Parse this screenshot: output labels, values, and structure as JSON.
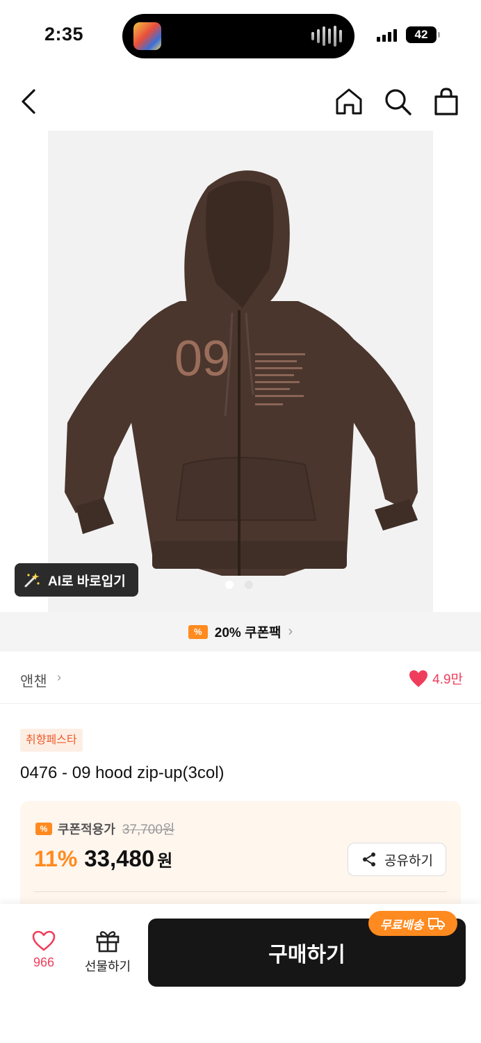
{
  "status_bar": {
    "time": "2:35",
    "battery": "42"
  },
  "nav": {
    "back_icon": "chevron-left-icon",
    "home_icon": "home-icon",
    "search_icon": "search-icon",
    "bag_icon": "shopping-bag-icon"
  },
  "product_image": {
    "print_number": "09",
    "ai_button_label": "AI로 바로입기",
    "page_count": 2,
    "current_page": 1,
    "hoodie_color": "#4a362d"
  },
  "coupon_strip": {
    "icon_text": "%",
    "label": "20% 쿠폰팩"
  },
  "brand": {
    "name": "앤챈",
    "likes": "4.9만"
  },
  "product": {
    "tag": "취향페스타",
    "title": "0476 - 09 hood zip-up(3col)"
  },
  "price": {
    "label": "쿠폰적용가",
    "original": "37,700원",
    "discount": "11%",
    "value": "33,480",
    "unit": "원",
    "share_label": "공유하기"
  },
  "bottom_bar": {
    "wish_count": "966",
    "gift_label": "선물하기",
    "buy_label": "구매하기",
    "free_shipping_label": "무료배송"
  },
  "colors": {
    "accent_orange": "#ff8a1f",
    "heart_red": "#ef3e5b",
    "buy_button": "#161616"
  }
}
